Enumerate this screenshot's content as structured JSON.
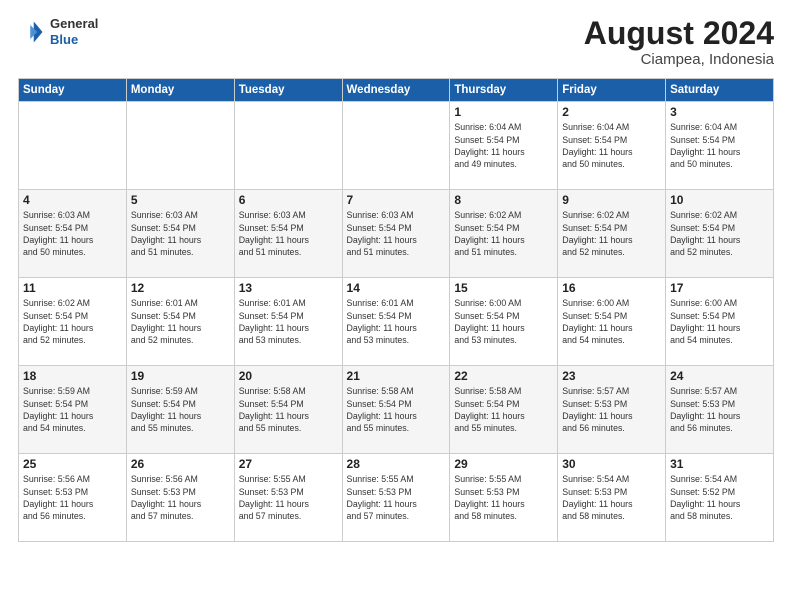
{
  "header": {
    "logo": {
      "general": "General",
      "blue": "Blue"
    },
    "title": "August 2024",
    "location": "Ciampea, Indonesia"
  },
  "calendar": {
    "weekdays": [
      "Sunday",
      "Monday",
      "Tuesday",
      "Wednesday",
      "Thursday",
      "Friday",
      "Saturday"
    ],
    "weeks": [
      [
        {
          "day": "",
          "info": ""
        },
        {
          "day": "",
          "info": ""
        },
        {
          "day": "",
          "info": ""
        },
        {
          "day": "",
          "info": ""
        },
        {
          "day": "1",
          "info": "Sunrise: 6:04 AM\nSunset: 5:54 PM\nDaylight: 11 hours\nand 49 minutes."
        },
        {
          "day": "2",
          "info": "Sunrise: 6:04 AM\nSunset: 5:54 PM\nDaylight: 11 hours\nand 50 minutes."
        },
        {
          "day": "3",
          "info": "Sunrise: 6:04 AM\nSunset: 5:54 PM\nDaylight: 11 hours\nand 50 minutes."
        }
      ],
      [
        {
          "day": "4",
          "info": "Sunrise: 6:03 AM\nSunset: 5:54 PM\nDaylight: 11 hours\nand 50 minutes."
        },
        {
          "day": "5",
          "info": "Sunrise: 6:03 AM\nSunset: 5:54 PM\nDaylight: 11 hours\nand 51 minutes."
        },
        {
          "day": "6",
          "info": "Sunrise: 6:03 AM\nSunset: 5:54 PM\nDaylight: 11 hours\nand 51 minutes."
        },
        {
          "day": "7",
          "info": "Sunrise: 6:03 AM\nSunset: 5:54 PM\nDaylight: 11 hours\nand 51 minutes."
        },
        {
          "day": "8",
          "info": "Sunrise: 6:02 AM\nSunset: 5:54 PM\nDaylight: 11 hours\nand 51 minutes."
        },
        {
          "day": "9",
          "info": "Sunrise: 6:02 AM\nSunset: 5:54 PM\nDaylight: 11 hours\nand 52 minutes."
        },
        {
          "day": "10",
          "info": "Sunrise: 6:02 AM\nSunset: 5:54 PM\nDaylight: 11 hours\nand 52 minutes."
        }
      ],
      [
        {
          "day": "11",
          "info": "Sunrise: 6:02 AM\nSunset: 5:54 PM\nDaylight: 11 hours\nand 52 minutes."
        },
        {
          "day": "12",
          "info": "Sunrise: 6:01 AM\nSunset: 5:54 PM\nDaylight: 11 hours\nand 52 minutes."
        },
        {
          "day": "13",
          "info": "Sunrise: 6:01 AM\nSunset: 5:54 PM\nDaylight: 11 hours\nand 53 minutes."
        },
        {
          "day": "14",
          "info": "Sunrise: 6:01 AM\nSunset: 5:54 PM\nDaylight: 11 hours\nand 53 minutes."
        },
        {
          "day": "15",
          "info": "Sunrise: 6:00 AM\nSunset: 5:54 PM\nDaylight: 11 hours\nand 53 minutes."
        },
        {
          "day": "16",
          "info": "Sunrise: 6:00 AM\nSunset: 5:54 PM\nDaylight: 11 hours\nand 54 minutes."
        },
        {
          "day": "17",
          "info": "Sunrise: 6:00 AM\nSunset: 5:54 PM\nDaylight: 11 hours\nand 54 minutes."
        }
      ],
      [
        {
          "day": "18",
          "info": "Sunrise: 5:59 AM\nSunset: 5:54 PM\nDaylight: 11 hours\nand 54 minutes."
        },
        {
          "day": "19",
          "info": "Sunrise: 5:59 AM\nSunset: 5:54 PM\nDaylight: 11 hours\nand 55 minutes."
        },
        {
          "day": "20",
          "info": "Sunrise: 5:58 AM\nSunset: 5:54 PM\nDaylight: 11 hours\nand 55 minutes."
        },
        {
          "day": "21",
          "info": "Sunrise: 5:58 AM\nSunset: 5:54 PM\nDaylight: 11 hours\nand 55 minutes."
        },
        {
          "day": "22",
          "info": "Sunrise: 5:58 AM\nSunset: 5:54 PM\nDaylight: 11 hours\nand 55 minutes."
        },
        {
          "day": "23",
          "info": "Sunrise: 5:57 AM\nSunset: 5:53 PM\nDaylight: 11 hours\nand 56 minutes."
        },
        {
          "day": "24",
          "info": "Sunrise: 5:57 AM\nSunset: 5:53 PM\nDaylight: 11 hours\nand 56 minutes."
        }
      ],
      [
        {
          "day": "25",
          "info": "Sunrise: 5:56 AM\nSunset: 5:53 PM\nDaylight: 11 hours\nand 56 minutes."
        },
        {
          "day": "26",
          "info": "Sunrise: 5:56 AM\nSunset: 5:53 PM\nDaylight: 11 hours\nand 57 minutes."
        },
        {
          "day": "27",
          "info": "Sunrise: 5:55 AM\nSunset: 5:53 PM\nDaylight: 11 hours\nand 57 minutes."
        },
        {
          "day": "28",
          "info": "Sunrise: 5:55 AM\nSunset: 5:53 PM\nDaylight: 11 hours\nand 57 minutes."
        },
        {
          "day": "29",
          "info": "Sunrise: 5:55 AM\nSunset: 5:53 PM\nDaylight: 11 hours\nand 58 minutes."
        },
        {
          "day": "30",
          "info": "Sunrise: 5:54 AM\nSunset: 5:53 PM\nDaylight: 11 hours\nand 58 minutes."
        },
        {
          "day": "31",
          "info": "Sunrise: 5:54 AM\nSunset: 5:52 PM\nDaylight: 11 hours\nand 58 minutes."
        }
      ]
    ]
  }
}
